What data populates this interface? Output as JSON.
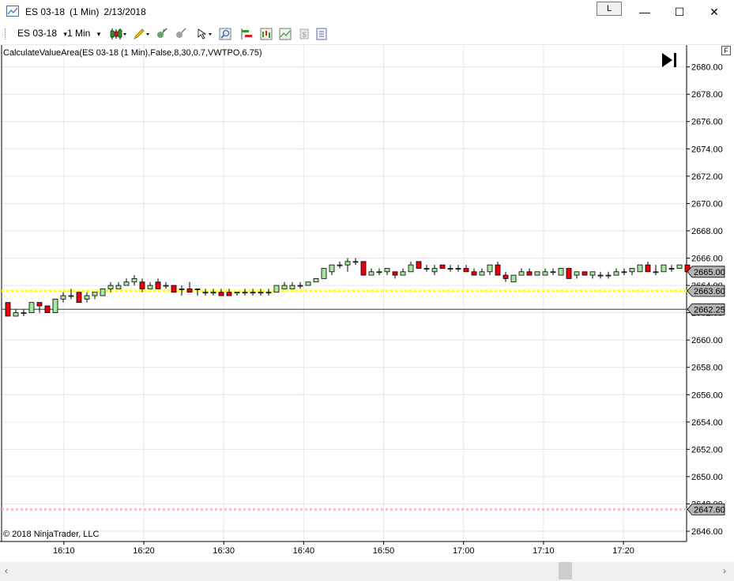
{
  "window": {
    "instrument": "ES 03-18",
    "interval": "(1 Min)",
    "date": "2/13/2018",
    "link_label": "L",
    "minimize": "—",
    "maximize": "☐",
    "close": "✕"
  },
  "toolbar": {
    "instrument": "ES 03-18",
    "interval": "1 Min",
    "dropdown_glyph": "▾",
    "icons": [
      "bar-type-icon",
      "drawing-tool-icon",
      "add-indicator-icon",
      "strategy-icon",
      "pointer-icon",
      "zoom-icon",
      "properties-icon",
      "chart-trader-icon",
      "performance-icon",
      "cash-icon",
      "notes-icon"
    ]
  },
  "chart_title": "CalculateValueArea(ES 03-18 (1 Min),False,8,30,0.7,VWTPO,6.75)",
  "copyright": "© 2018 NinjaTrader, LLC",
  "f_badge": "F",
  "scroll": {
    "left": "‹",
    "right": "›"
  },
  "colors": {
    "up": "#a8e6a1",
    "down": "#e8000b",
    "wick": "#000000",
    "value_area_high": "#ffff00",
    "value_area_low": "#ffb6c1",
    "poc_line": "#006400",
    "grid": "#e6e6e6",
    "price_label_bg": "#b4b4b4"
  },
  "chart_data": {
    "type": "candlestick",
    "title": "CalculateValueArea(ES 03-18 (1 Min),False,8,30,0.7,VWTPO,6.75)",
    "ylim": [
      2645.25,
      2681.6
    ],
    "yticks": [
      "2680.00",
      "2678.00",
      "2676.00",
      "2674.00",
      "2672.00",
      "2670.00",
      "2668.00",
      "2666.00",
      "2664.00",
      "2662.00",
      "2660.00",
      "2658.00",
      "2656.00",
      "2654.00",
      "2652.00",
      "2650.00",
      "2648.00",
      "2646.00"
    ],
    "xticks": [
      "16:10",
      "16:20",
      "16:30",
      "16:40",
      "16:50",
      "17:00",
      "17:10",
      "17:20"
    ],
    "first_bar_time": "16:03",
    "last_bar_time": "17:28",
    "ohlc": [
      [
        2662.75,
        2662.75,
        2661.75,
        2661.75
      ],
      [
        2661.75,
        2662.25,
        2661.75,
        2662.0
      ],
      [
        2662.0,
        2662.25,
        2661.75,
        2662.0
      ],
      [
        2662.0,
        2662.75,
        2662.0,
        2662.75
      ],
      [
        2662.75,
        2662.75,
        2662.0,
        2662.5
      ],
      [
        2662.5,
        2662.5,
        2662.0,
        2662.0
      ],
      [
        2662.0,
        2663.0,
        2662.0,
        2663.0
      ],
      [
        2663.0,
        2663.5,
        2662.75,
        2663.25
      ],
      [
        2663.25,
        2663.75,
        2663.0,
        2663.25
      ],
      [
        2663.5,
        2663.5,
        2662.75,
        2662.75
      ],
      [
        2663.0,
        2663.5,
        2662.75,
        2663.25
      ],
      [
        2663.25,
        2663.5,
        2663.0,
        2663.5
      ],
      [
        2663.25,
        2663.75,
        2663.25,
        2663.75
      ],
      [
        2663.75,
        2664.25,
        2663.5,
        2664.0
      ],
      [
        2663.75,
        2664.25,
        2663.75,
        2664.0
      ],
      [
        2664.0,
        2664.5,
        2664.0,
        2664.25
      ],
      [
        2664.25,
        2664.75,
        2664.0,
        2664.5
      ],
      [
        2664.25,
        2664.5,
        2663.5,
        2663.75
      ],
      [
        2663.75,
        2664.25,
        2663.75,
        2664.0
      ],
      [
        2664.25,
        2664.5,
        2663.75,
        2663.75
      ],
      [
        2664.0,
        2664.25,
        2663.75,
        2664.0
      ],
      [
        2664.0,
        2664.0,
        2663.5,
        2663.5
      ],
      [
        2663.75,
        2664.0,
        2663.25,
        2663.75
      ],
      [
        2663.75,
        2664.25,
        2663.5,
        2663.5
      ],
      [
        2663.75,
        2663.75,
        2663.25,
        2663.75
      ],
      [
        2663.5,
        2663.75,
        2663.25,
        2663.5
      ],
      [
        2663.5,
        2663.75,
        2663.25,
        2663.5
      ],
      [
        2663.5,
        2663.75,
        2663.25,
        2663.25
      ],
      [
        2663.5,
        2663.75,
        2663.25,
        2663.25
      ],
      [
        2663.5,
        2663.5,
        2663.25,
        2663.5
      ],
      [
        2663.5,
        2663.75,
        2663.25,
        2663.5
      ],
      [
        2663.5,
        2663.75,
        2663.25,
        2663.5
      ],
      [
        2663.5,
        2663.75,
        2663.25,
        2663.5
      ],
      [
        2663.5,
        2663.75,
        2663.25,
        2663.5
      ],
      [
        2663.5,
        2664.0,
        2663.5,
        2664.0
      ],
      [
        2663.75,
        2664.25,
        2663.75,
        2664.0
      ],
      [
        2663.75,
        2664.25,
        2663.75,
        2664.0
      ],
      [
        2664.0,
        2664.25,
        2663.75,
        2664.0
      ],
      [
        2664.0,
        2664.25,
        2664.0,
        2664.25
      ],
      [
        2664.25,
        2664.5,
        2664.25,
        2664.5
      ],
      [
        2664.5,
        2665.25,
        2664.5,
        2665.25
      ],
      [
        2665.0,
        2665.5,
        2664.75,
        2665.5
      ],
      [
        2665.5,
        2665.75,
        2665.25,
        2665.5
      ],
      [
        2665.5,
        2666.0,
        2665.0,
        2665.75
      ],
      [
        2665.75,
        2666.0,
        2665.5,
        2665.75
      ],
      [
        2665.75,
        2665.75,
        2664.75,
        2664.75
      ],
      [
        2664.75,
        2665.25,
        2664.75,
        2665.0
      ],
      [
        2665.0,
        2665.25,
        2664.75,
        2665.0
      ],
      [
        2665.0,
        2665.25,
        2664.75,
        2665.25
      ],
      [
        2665.0,
        2665.0,
        2664.5,
        2664.75
      ],
      [
        2664.75,
        2665.25,
        2664.75,
        2665.0
      ],
      [
        2665.0,
        2665.75,
        2665.0,
        2665.5
      ],
      [
        2665.75,
        2665.75,
        2665.25,
        2665.25
      ],
      [
        2665.25,
        2665.5,
        2665.0,
        2665.25
      ],
      [
        2665.0,
        2665.5,
        2664.75,
        2665.25
      ],
      [
        2665.5,
        2665.5,
        2665.25,
        2665.25
      ],
      [
        2665.25,
        2665.5,
        2665.0,
        2665.25
      ],
      [
        2665.25,
        2665.5,
        2665.0,
        2665.25
      ],
      [
        2665.25,
        2665.5,
        2665.0,
        2665.0
      ],
      [
        2665.0,
        2665.25,
        2664.75,
        2664.75
      ],
      [
        2664.75,
        2665.25,
        2664.75,
        2665.0
      ],
      [
        2665.0,
        2665.5,
        2664.75,
        2665.5
      ],
      [
        2665.5,
        2665.75,
        2664.75,
        2664.75
      ],
      [
        2664.75,
        2665.0,
        2664.25,
        2664.5
      ],
      [
        2664.25,
        2664.75,
        2664.25,
        2664.75
      ],
      [
        2664.75,
        2665.25,
        2664.75,
        2665.0
      ],
      [
        2665.0,
        2665.25,
        2664.75,
        2664.75
      ],
      [
        2664.75,
        2665.0,
        2664.75,
        2665.0
      ],
      [
        2664.75,
        2665.25,
        2664.75,
        2665.0
      ],
      [
        2665.0,
        2665.25,
        2664.75,
        2665.0
      ],
      [
        2664.75,
        2665.25,
        2664.75,
        2665.25
      ],
      [
        2665.25,
        2665.25,
        2664.5,
        2664.5
      ],
      [
        2664.75,
        2665.0,
        2664.5,
        2665.0
      ],
      [
        2665.0,
        2665.0,
        2664.75,
        2664.75
      ],
      [
        2664.75,
        2665.0,
        2664.5,
        2665.0
      ],
      [
        2664.75,
        2665.0,
        2664.5,
        2664.75
      ],
      [
        2664.75,
        2665.0,
        2664.5,
        2664.75
      ],
      [
        2664.75,
        2665.25,
        2664.75,
        2665.0
      ],
      [
        2665.0,
        2665.25,
        2664.75,
        2665.0
      ],
      [
        2665.0,
        2665.25,
        2664.75,
        2665.25
      ],
      [
        2665.0,
        2665.5,
        2665.0,
        2665.5
      ],
      [
        2665.5,
        2665.75,
        2665.0,
        2665.0
      ],
      [
        2665.0,
        2665.5,
        2664.75,
        2665.0
      ],
      [
        2665.0,
        2665.5,
        2665.0,
        2665.5
      ],
      [
        2665.25,
        2665.5,
        2665.0,
        2665.25
      ],
      [
        2665.25,
        2665.5,
        2665.25,
        2665.5
      ],
      [
        2665.5,
        2665.5,
        2665.0,
        2665.0
      ]
    ],
    "levels": [
      {
        "name": "value-area-high",
        "value": 2663.6,
        "label": "2663.60",
        "style": "dotted",
        "color": "#ffff00"
      },
      {
        "name": "poc",
        "value": 2662.25,
        "label": "2662.25",
        "style": "solid",
        "color": "#006400"
      },
      {
        "name": "value-area-low",
        "value": 2647.6,
        "label": "2647.60",
        "style": "dotted",
        "color": "#ffb6c1"
      }
    ],
    "last_price": {
      "value": 2665.0,
      "label": "2665.00"
    },
    "grid": true
  }
}
